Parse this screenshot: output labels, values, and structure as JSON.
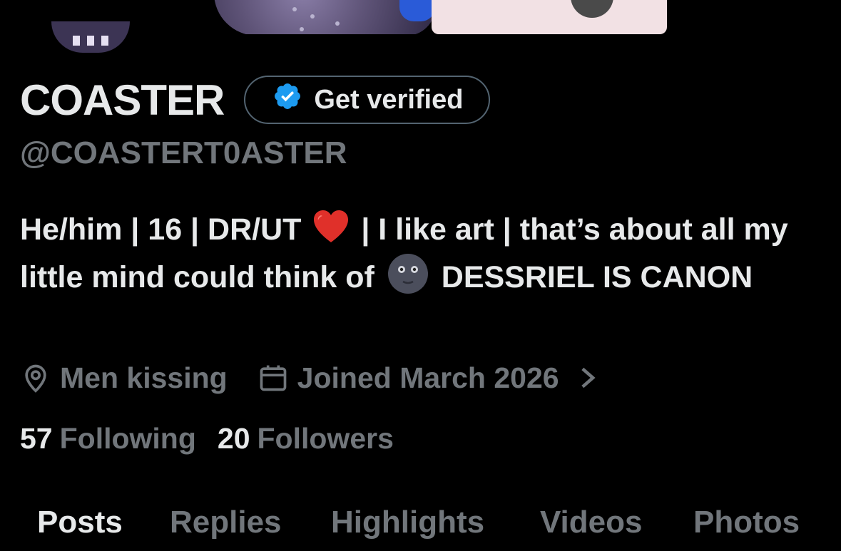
{
  "profile": {
    "display_name": "COASTER",
    "verify_label": "Get verified",
    "handle": "@COASTERT0ASTER",
    "bio_part1": "He/him | 16 | DR/UT",
    "bio_part2": " | I like art | that’s about all my little mind could think of",
    "bio_part3": "DESSRIEL IS CANON",
    "location": "Men kissing",
    "joined": "Joined March 2026",
    "following_count": "57",
    "following_label": "Following",
    "followers_count": "20",
    "followers_label": "Followers"
  },
  "icons": {
    "verified": "verified-badge-icon",
    "location": "location-pin-icon",
    "calendar": "calendar-icon",
    "chevron": "chevron-right-icon",
    "heart": "red-heart-emoji",
    "moon": "new-moon-face-emoji"
  },
  "colors": {
    "background": "#000000",
    "primary_text": "#e7e9ea",
    "secondary_text": "#71767b",
    "verified_blue": "#1d9bf0",
    "border": "#536471"
  },
  "tabs": [
    {
      "label": "Posts",
      "active": true
    },
    {
      "label": "Replies",
      "active": false
    },
    {
      "label": "Highlights",
      "active": false
    },
    {
      "label": "Videos",
      "active": false
    },
    {
      "label": "Photos",
      "active": false
    }
  ]
}
